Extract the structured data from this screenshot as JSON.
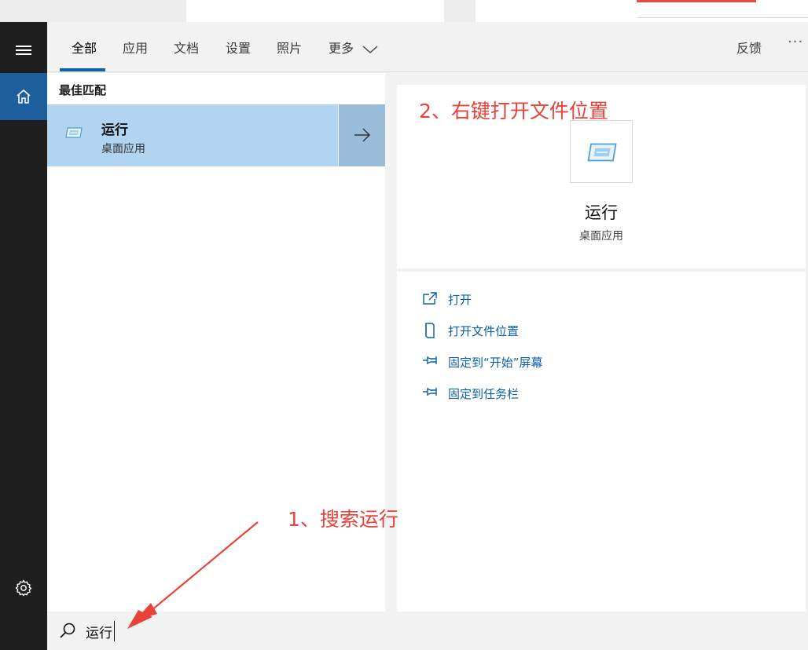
{
  "tabs": [
    {
      "label": "全部"
    },
    {
      "label": "应用"
    },
    {
      "label": "文档"
    },
    {
      "label": "设置"
    },
    {
      "label": "照片"
    },
    {
      "label": "更多"
    }
  ],
  "header": {
    "feedback_label": "反馈",
    "more_label": "···"
  },
  "results": {
    "section_title": "最佳匹配",
    "best_match": {
      "name": "运行",
      "type": "桌面应用"
    }
  },
  "preview": {
    "name": "运行",
    "type": "桌面应用",
    "actions": [
      {
        "label": "打开",
        "icon": "open-icon"
      },
      {
        "label": "打开文件位置",
        "icon": "file-location-icon"
      },
      {
        "label": "固定到“开始”屏幕",
        "icon": "pin-icon"
      },
      {
        "label": "固定到任务栏",
        "icon": "pin-icon"
      }
    ]
  },
  "search": {
    "value": "运行"
  },
  "annotations": {
    "step1": "1、搜索运行",
    "step2": "2、右键打开文件位置"
  },
  "colors": {
    "accent": "#0a64ad",
    "selected_bg": "#b1d5f0",
    "rail_bg": "#1f1f1f",
    "annotation": "#e8423a"
  }
}
